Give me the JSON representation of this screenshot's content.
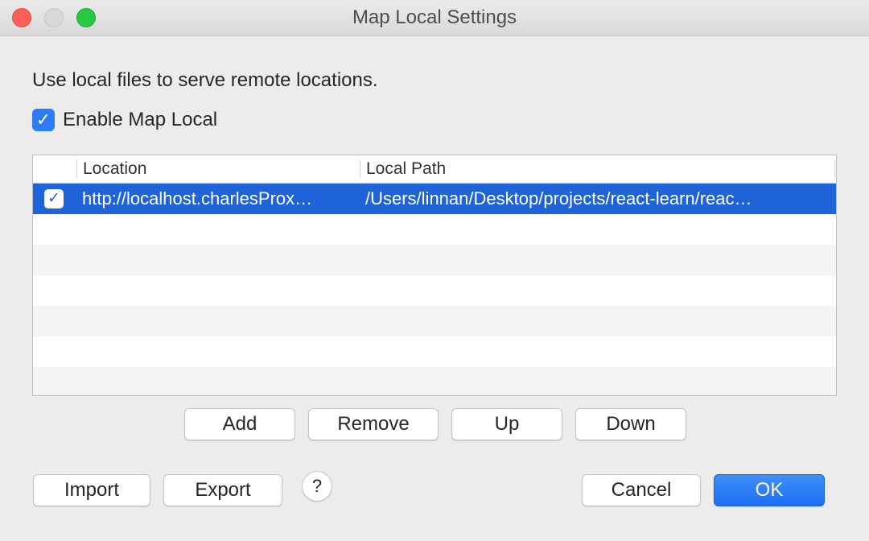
{
  "window": {
    "title": "Map Local Settings"
  },
  "description": "Use local files to serve remote locations.",
  "enable_map_local": {
    "label": "Enable Map Local",
    "checked": true,
    "check_glyph": "✓"
  },
  "table": {
    "columns": [
      "",
      "Location",
      "Local Path"
    ],
    "rows": [
      {
        "enabled": true,
        "check_glyph": "✓",
        "location": "http://localhost.charlesProx…",
        "local_path": "/Users/linnan/Desktop/projects/react-learn/reac…"
      }
    ]
  },
  "buttons": {
    "add": "Add",
    "remove": "Remove",
    "up": "Up",
    "down": "Down",
    "import": "Import",
    "export": "Export",
    "help": "?",
    "cancel": "Cancel",
    "ok": "OK"
  },
  "colors": {
    "accent": "#1f63d8",
    "primary_button": "#2a7cf7",
    "close": "#fe5f57",
    "maximize": "#28c840"
  }
}
